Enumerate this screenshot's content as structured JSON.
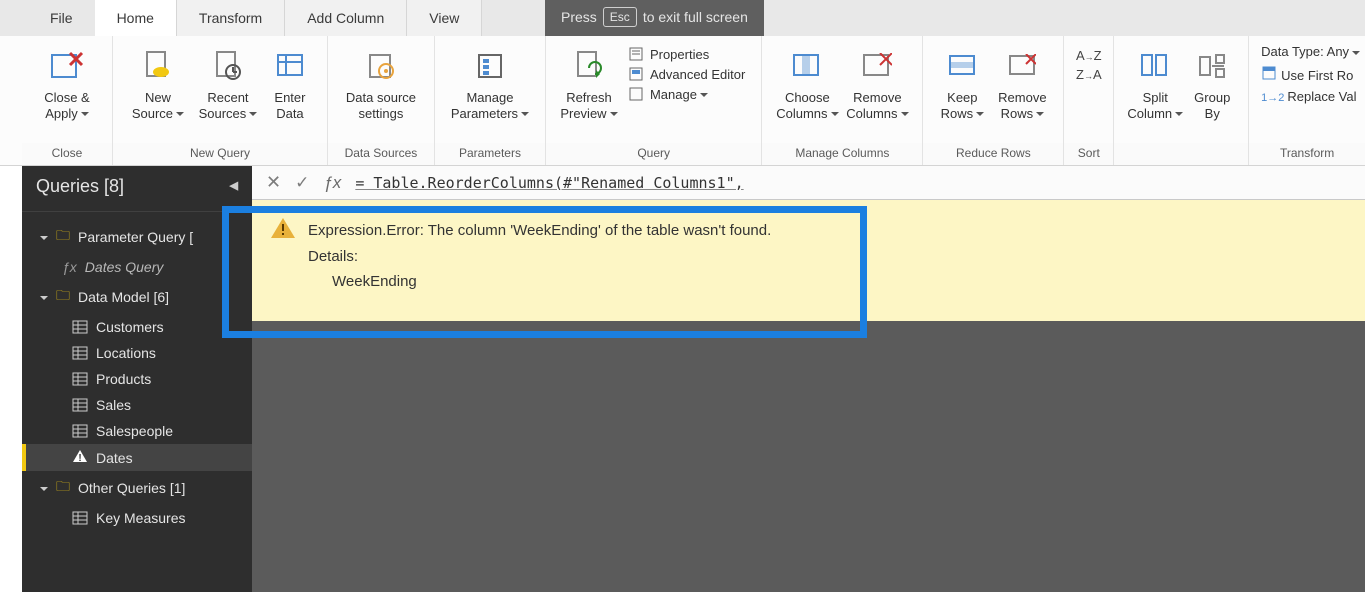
{
  "overlay": {
    "pre": "Press",
    "key": "Esc",
    "post": "to exit full screen"
  },
  "tabs": {
    "file": "File",
    "home": "Home",
    "transform": "Transform",
    "addcol": "Add Column",
    "view": "View"
  },
  "ribbon": {
    "close": {
      "close_apply": "Close &\nApply",
      "group": "Close"
    },
    "newquery": {
      "new_source": "New\nSource",
      "recent": "Recent\nSources",
      "enter": "Enter\nData",
      "group": "New Query"
    },
    "datasources": {
      "settings": "Data source\nsettings",
      "group": "Data Sources"
    },
    "parameters": {
      "manage": "Manage\nParameters",
      "group": "Parameters"
    },
    "query": {
      "refresh": "Refresh\nPreview",
      "properties": "Properties",
      "adv": "Advanced Editor",
      "manage": "Manage",
      "group": "Query"
    },
    "managecols": {
      "choose": "Choose\nColumns",
      "remove": "Remove\nColumns",
      "group": "Manage Columns"
    },
    "reducerows": {
      "keep": "Keep\nRows",
      "remove": "Remove\nRows",
      "group": "Reduce Rows"
    },
    "sort": {
      "group": "Sort"
    },
    "splitgroup": {
      "split": "Split\nColumn",
      "groupby": "Group\nBy"
    },
    "transform": {
      "datatype": "Data Type: Any",
      "firstrow": "Use First Ro",
      "replace": "Replace Val",
      "group": "Transform"
    }
  },
  "sidebar": {
    "header": "Queries [8]",
    "param_group": "Parameter Query [",
    "dates_query": "Dates Query",
    "data_model": "Data Model [6]",
    "items": {
      "customers": "Customers",
      "locations": "Locations",
      "products": "Products",
      "sales": "Sales",
      "salespeople": "Salespeople",
      "dates": "Dates"
    },
    "other": "Other Queries [1]",
    "key_measures": "Key Measures"
  },
  "formula": "= Table.ReorderColumns(#\"Renamed Columns1\",",
  "error": {
    "line1": "Expression.Error: The column 'WeekEnding' of the table wasn't found.",
    "details_label": "Details:",
    "details_value": "WeekEnding"
  }
}
